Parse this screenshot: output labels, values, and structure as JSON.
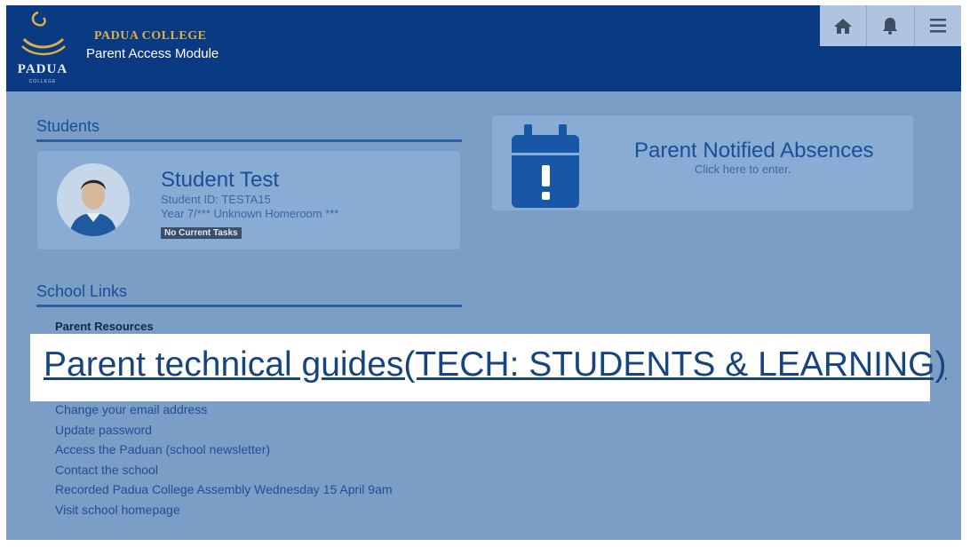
{
  "header": {
    "logo_text": "PADUA",
    "logo_subtext": "COLLEGE",
    "college_name": "PADUA COLLEGE",
    "module_name": "Parent Access Module",
    "buttons": [
      {
        "icon": "home-icon"
      },
      {
        "icon": "bell-icon"
      },
      {
        "icon": "menu-icon"
      }
    ]
  },
  "students": {
    "title": "Students",
    "student": {
      "name": "Student Test",
      "id_line": "Student ID: TESTA15",
      "year_line": "Year 7/*** Unknown Homeroom ***",
      "badge": "No Current Tasks"
    }
  },
  "absences": {
    "icon": "calendar-exclamation-icon",
    "title": "Parent Notified Absences",
    "subtitle": "Click here to enter."
  },
  "school_links": {
    "title": "School Links",
    "resources_heading": "Parent Resources",
    "highlighted_link": "Parent technical guides(TECH: STUDENTS & LEARNING)",
    "links": [
      "Change your email address",
      "Update password",
      "Access the Paduan (school newsletter)",
      "Contact the school",
      "Recorded Padua College Assembly Wednesday 15 April 9am",
      "Visit school homepage"
    ]
  },
  "colors": {
    "header": "#0a3b82",
    "page_overlay": "#7a9ec6",
    "accent": "#1a4f96",
    "gold": "#d9b04a"
  }
}
